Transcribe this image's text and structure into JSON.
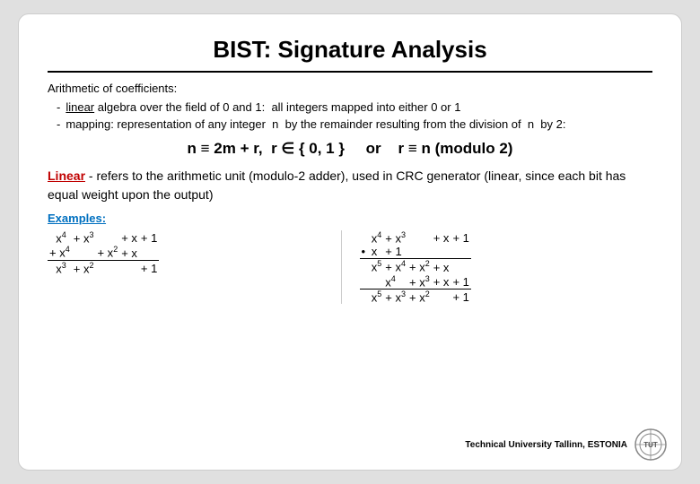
{
  "slide": {
    "title": "BIST: Signature Analysis",
    "divider": true,
    "arithmetic_label": "Arithmetic of coefficients:",
    "bullets": [
      {
        "id": "bullet1",
        "prefix": "linear",
        "prefix_underline": true,
        "text": " algebra over the field of 0 and 1:  all integers mapped into either 0 or 1"
      },
      {
        "id": "bullet2",
        "text": "mapping: representation of any integer  n  by the remainder resulting from the division of  n  by 2:"
      }
    ],
    "formula": "n ≡ 2m + r,  r ∈ { 0, 1 }    or    r ≡ n (modulo 2)",
    "linear_section": " - refers to the arithmetic unit (modulo-2 adder), used in CRC generator (linear, since each bit has equal weight upon the output)",
    "linear_word": "Linear",
    "examples_label": "Examples:",
    "footer": {
      "text": "Technical University Tallinn, ESTONIA"
    }
  }
}
